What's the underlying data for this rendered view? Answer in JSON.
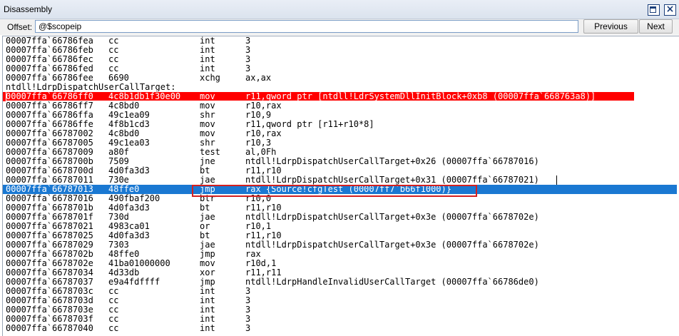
{
  "window": {
    "title": "Disassembly",
    "restore_icon": "restore-icon",
    "close_icon": "close-icon",
    "close_glyph": "×"
  },
  "toolbar": {
    "offset_label": "Offset:",
    "offset_value": "@$scopeip",
    "prev_label": "Previous",
    "next_label": "Next"
  },
  "colors": {
    "breakpoint": "#ff0000",
    "current": "#1a78d2",
    "highlight_outline": "#d32020"
  },
  "lines": [
    {
      "addr": "00007ffa`66786fea",
      "bytes": "cc",
      "mnem": "int",
      "ops": "3"
    },
    {
      "addr": "00007ffa`66786feb",
      "bytes": "cc",
      "mnem": "int",
      "ops": "3"
    },
    {
      "addr": "00007ffa`66786fec",
      "bytes": "cc",
      "mnem": "int",
      "ops": "3"
    },
    {
      "addr": "00007ffa`66786fed",
      "bytes": "cc",
      "mnem": "int",
      "ops": "3"
    },
    {
      "addr": "00007ffa`66786fee",
      "bytes": "6690",
      "mnem": "xchg",
      "ops": "ax,ax"
    },
    {
      "label": "ntdll!LdrpDispatchUserCallTarget:"
    },
    {
      "addr": "00007ffa`66786ff0",
      "bytes": "4c8b1db1f30e00",
      "mnem": "mov",
      "ops": "r11,qword ptr [ntdll!LdrSystemDllInitBlock+0xb8 (00007ffa`668763a8)]",
      "state": "breakpoint"
    },
    {
      "addr": "00007ffa`66786ff7",
      "bytes": "4c8bd0",
      "mnem": "mov",
      "ops": "r10,rax"
    },
    {
      "addr": "00007ffa`66786ffa",
      "bytes": "49c1ea09",
      "mnem": "shr",
      "ops": "r10,9"
    },
    {
      "addr": "00007ffa`66786ffe",
      "bytes": "4f8b1cd3",
      "mnem": "mov",
      "ops": "r11,qword ptr [r11+r10*8]"
    },
    {
      "addr": "00007ffa`66787002",
      "bytes": "4c8bd0",
      "mnem": "mov",
      "ops": "r10,rax"
    },
    {
      "addr": "00007ffa`66787005",
      "bytes": "49c1ea03",
      "mnem": "shr",
      "ops": "r10,3"
    },
    {
      "addr": "00007ffa`66787009",
      "bytes": "a80f",
      "mnem": "test",
      "ops": "al,0Fh"
    },
    {
      "addr": "00007ffa`6678700b",
      "bytes": "7509",
      "mnem": "jne",
      "ops": "ntdll!LdrpDispatchUserCallTarget+0x26 (00007ffa`66787016)"
    },
    {
      "addr": "00007ffa`6678700d",
      "bytes": "4d0fa3d3",
      "mnem": "bt",
      "ops": "r11,r10"
    },
    {
      "addr": "00007ffa`66787011",
      "bytes": "730e",
      "mnem": "jae",
      "ops": "ntdll!LdrpDispatchUserCallTarget+0x31 (00007ffa`66787021)"
    },
    {
      "addr": "00007ffa`66787013",
      "bytes": "48ffe0",
      "mnem": "jmp",
      "ops": "rax {Source!cfgTest (00007ff7`b66f1000)}",
      "state": "current"
    },
    {
      "addr": "00007ffa`66787016",
      "bytes": "490fbaf200",
      "mnem": "btr",
      "ops": "r10,0"
    },
    {
      "addr": "00007ffa`6678701b",
      "bytes": "4d0fa3d3",
      "mnem": "bt",
      "ops": "r11,r10"
    },
    {
      "addr": "00007ffa`6678701f",
      "bytes": "730d",
      "mnem": "jae",
      "ops": "ntdll!LdrpDispatchUserCallTarget+0x3e (00007ffa`6678702e)"
    },
    {
      "addr": "00007ffa`66787021",
      "bytes": "4983ca01",
      "mnem": "or",
      "ops": "r10,1"
    },
    {
      "addr": "00007ffa`66787025",
      "bytes": "4d0fa3d3",
      "mnem": "bt",
      "ops": "r11,r10"
    },
    {
      "addr": "00007ffa`66787029",
      "bytes": "7303",
      "mnem": "jae",
      "ops": "ntdll!LdrpDispatchUserCallTarget+0x3e (00007ffa`6678702e)"
    },
    {
      "addr": "00007ffa`6678702b",
      "bytes": "48ffe0",
      "mnem": "jmp",
      "ops": "rax"
    },
    {
      "addr": "00007ffa`6678702e",
      "bytes": "41ba01000000",
      "mnem": "mov",
      "ops": "r10d,1"
    },
    {
      "addr": "00007ffa`66787034",
      "bytes": "4d33db",
      "mnem": "xor",
      "ops": "r11,r11"
    },
    {
      "addr": "00007ffa`66787037",
      "bytes": "e9a4fdffff",
      "mnem": "jmp",
      "ops": "ntdll!LdrpHandleInvalidUserCallTarget (00007ffa`66786de0)"
    },
    {
      "addr": "00007ffa`6678703c",
      "bytes": "cc",
      "mnem": "int",
      "ops": "3"
    },
    {
      "addr": "00007ffa`6678703d",
      "bytes": "cc",
      "mnem": "int",
      "ops": "3"
    },
    {
      "addr": "00007ffa`6678703e",
      "bytes": "cc",
      "mnem": "int",
      "ops": "3"
    },
    {
      "addr": "00007ffa`6678703f",
      "bytes": "cc",
      "mnem": "int",
      "ops": "3"
    },
    {
      "addr": "00007ffa`66787040",
      "bytes": "cc",
      "mnem": "int",
      "ops": "3"
    }
  ]
}
